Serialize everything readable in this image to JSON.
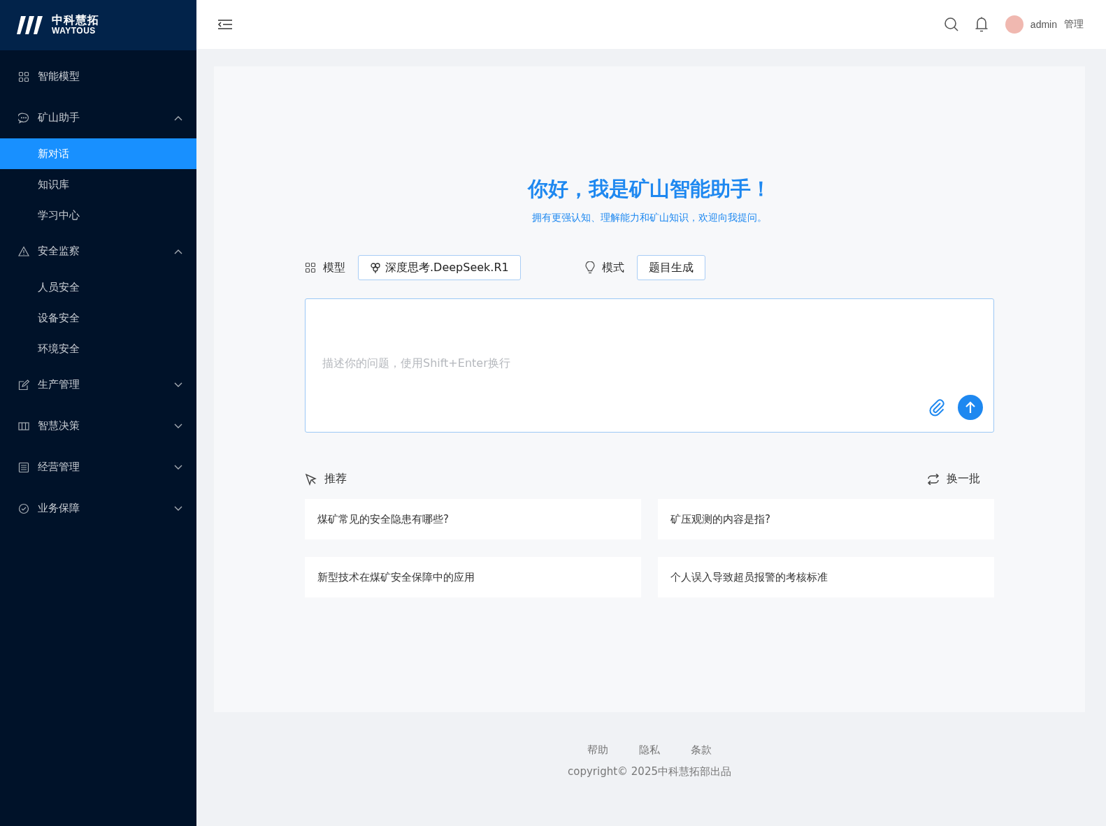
{
  "logo": {
    "name": "中科慧拓",
    "subtitle": "WAYTOUS"
  },
  "sidebar": {
    "items": [
      {
        "kind": "link",
        "label": "智能模型"
      },
      {
        "kind": "group",
        "label": "矿山助手",
        "expanded": true,
        "children": [
          {
            "label": "新对话",
            "selected": true
          },
          {
            "label": "知识库",
            "selected": false
          },
          {
            "label": "学习中心",
            "selected": false
          }
        ]
      },
      {
        "kind": "group",
        "label": "安全监察",
        "expanded": true,
        "children": [
          {
            "label": "人员安全",
            "selected": false
          },
          {
            "label": "设备安全",
            "selected": false
          },
          {
            "label": "环境安全",
            "selected": false
          }
        ]
      },
      {
        "kind": "group",
        "label": "生产管理",
        "expanded": false
      },
      {
        "kind": "group",
        "label": "智慧决策",
        "expanded": false
      },
      {
        "kind": "group",
        "label": "经营管理",
        "expanded": false
      },
      {
        "kind": "group",
        "label": "业务保障",
        "expanded": false
      }
    ]
  },
  "header": {
    "user": "admin",
    "role": "管理"
  },
  "welcome": {
    "title": "你好，我是矿山智能助手！",
    "subtitle": "拥有更强认知、理解能力和矿山知识，欢迎向我提问。"
  },
  "model": {
    "label": "模型",
    "value": "深度思考.DeepSeek.R1"
  },
  "mode": {
    "label": "模式",
    "value": "题目生成"
  },
  "prompt": {
    "placeholder": "描述你的问题，使用Shift+Enter换行"
  },
  "recommend": {
    "label": "推荐",
    "refresh": "换一批",
    "items": [
      "煤矿常见的安全隐患有哪些?",
      "矿压观测的内容是指?",
      "新型技术在煤矿安全保障中的应用",
      "个人误入导致超员报警的考核标准"
    ]
  },
  "footer": {
    "links": [
      "帮助",
      "隐私",
      "条款"
    ],
    "copyright": "copyright© 2025中科慧拓部出品"
  }
}
